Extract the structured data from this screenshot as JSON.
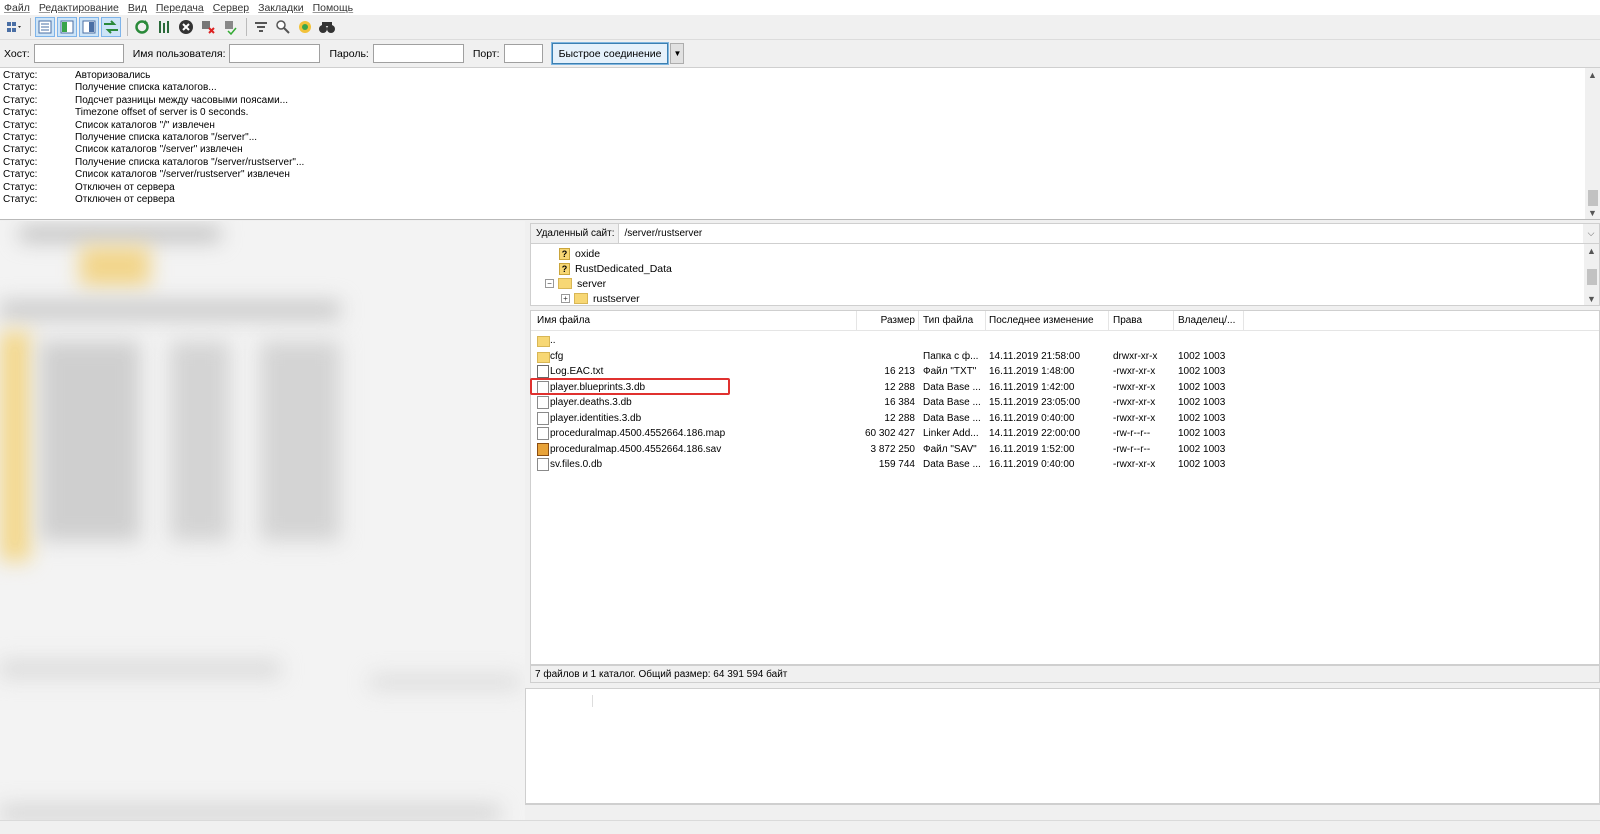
{
  "menu": [
    "Файл",
    "Редактирование",
    "Вид",
    "Передача",
    "Сервер",
    "Закладки",
    "Помощь"
  ],
  "quickconnect": {
    "host_label": "Хост:",
    "user_label": "Имя пользователя:",
    "pass_label": "Пароль:",
    "port_label": "Порт:",
    "host_value": "",
    "user_value": "",
    "pass_value": "",
    "port_value": "",
    "connect_label": "Быстрое соединение"
  },
  "log": [
    {
      "label": "Статус:",
      "text": "Авторизовались"
    },
    {
      "label": "Статус:",
      "text": "Получение списка каталогов..."
    },
    {
      "label": "Статус:",
      "text": "Подсчет разницы между часовыми поясами..."
    },
    {
      "label": "Статус:",
      "text": "Timezone offset of server is 0 seconds."
    },
    {
      "label": "Статус:",
      "text": "Список каталогов \"/\" извлечен"
    },
    {
      "label": "Статус:",
      "text": "Получение списка каталогов \"/server\"..."
    },
    {
      "label": "Статус:",
      "text": "Список каталогов \"/server\" извлечен"
    },
    {
      "label": "Статус:",
      "text": "Получение списка каталогов \"/server/rustserver\"..."
    },
    {
      "label": "Статус:",
      "text": "Список каталогов \"/server/rustserver\" извлечен"
    },
    {
      "label": "Статус:",
      "text": "Отключен от сервера"
    },
    {
      "label": "Статус:",
      "text": "Отключен от сервера"
    }
  ],
  "remote": {
    "label": "Удаленный сайт:",
    "path": "/server/rustserver",
    "tree": [
      "oxide",
      "RustDedicated_Data",
      "server",
      "rustserver"
    ]
  },
  "columns": [
    "Имя файла",
    "Размер",
    "Тип файла",
    "Последнее изменение",
    "Права",
    "Владелец/..."
  ],
  "files": [
    {
      "name": "..",
      "size": "",
      "type": "",
      "modified": "",
      "perms": "",
      "owner": "",
      "icon": "folder-icon"
    },
    {
      "name": "cfg",
      "size": "",
      "type": "Папка с ф...",
      "modified": "14.11.2019 21:58:00",
      "perms": "drwxr-xr-x",
      "owner": "1002 1003",
      "icon": "folder-icon"
    },
    {
      "name": "Log.EAC.txt",
      "size": "16 213",
      "type": "Файл \"TXT\"",
      "modified": "16.11.2019 1:48:00",
      "perms": "-rwxr-xr-x",
      "owner": "1002 1003",
      "icon": "text-file-icon"
    },
    {
      "name": "player.blueprints.3.db",
      "size": "12 288",
      "type": "Data Base ...",
      "modified": "16.11.2019 1:42:00",
      "perms": "-rwxr-xr-x",
      "owner": "1002 1003",
      "icon": "database-file-icon"
    },
    {
      "name": "player.deaths.3.db",
      "size": "16 384",
      "type": "Data Base ...",
      "modified": "15.11.2019 23:05:00",
      "perms": "-rwxr-xr-x",
      "owner": "1002 1003",
      "icon": "database-file-icon"
    },
    {
      "name": "player.identities.3.db",
      "size": "12 288",
      "type": "Data Base ...",
      "modified": "16.11.2019 0:40:00",
      "perms": "-rwxr-xr-x",
      "owner": "1002 1003",
      "icon": "database-file-icon"
    },
    {
      "name": "proceduralmap.4500.4552664.186.map",
      "size": "60 302 427",
      "type": "Linker Add...",
      "modified": "14.11.2019 22:00:00",
      "perms": "-rw-r--r--",
      "owner": "1002 1003",
      "icon": "map-file-icon"
    },
    {
      "name": "proceduralmap.4500.4552664.186.sav",
      "size": "3 872 250",
      "type": "Файл \"SAV\"",
      "modified": "16.11.2019 1:52:00",
      "perms": "-rw-r--r--",
      "owner": "1002 1003",
      "icon": "sav-file-icon"
    },
    {
      "name": "sv.files.0.db",
      "size": "159 744",
      "type": "Data Base ...",
      "modified": "16.11.2019 0:40:00",
      "perms": "-rwxr-xr-x",
      "owner": "1002 1003",
      "icon": "database-file-icon"
    }
  ],
  "summary": "7 файлов и 1 каталог. Общий размер: 64 391 594 байт",
  "highlight_color": "#e0312f"
}
